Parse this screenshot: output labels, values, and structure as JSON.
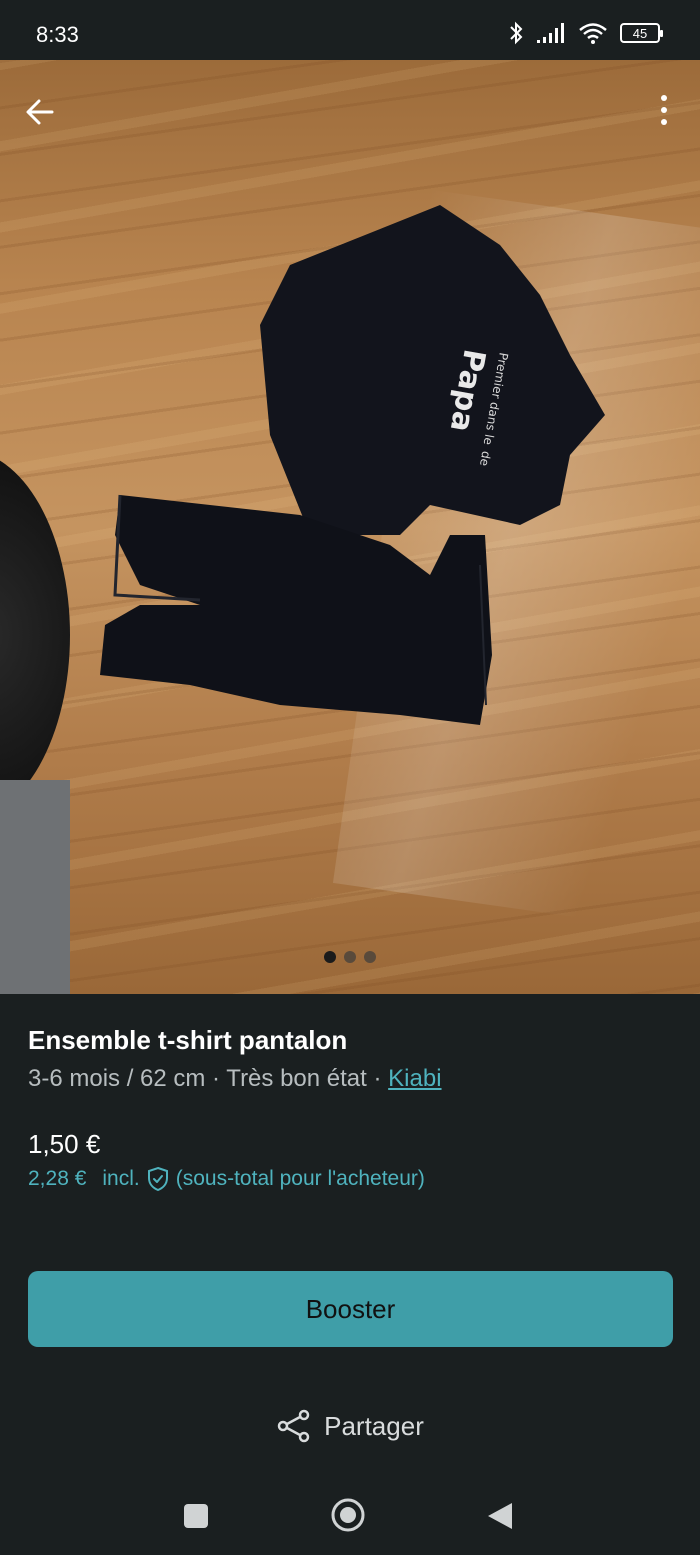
{
  "status_bar": {
    "time": "8:33",
    "battery": "45",
    "icons": [
      "bluetooth-icon",
      "signal-icon",
      "wifi-icon",
      "battery-icon"
    ]
  },
  "photo": {
    "indicator": {
      "count": 3,
      "active_index": 0
    },
    "shirt_print": {
      "line1": "Premier dans le",
      "line2": "Papa",
      "line3": "de"
    }
  },
  "item": {
    "title": "Ensemble t-shirt pantalon",
    "size": "3-6 mois / 62 cm",
    "separator": " · ",
    "condition": "Très bon état",
    "brand": "Kiabi"
  },
  "pricing": {
    "price": "1,50 €",
    "buyer_total": "2,28 €",
    "incl_label": "incl.",
    "buyer_note": "(sous-total pour l'acheteur)"
  },
  "actions": {
    "booster_label": "Booster",
    "share_label": "Partager"
  },
  "colors": {
    "background": "#1a1f20",
    "accent": "#3f9ea8",
    "link": "#4fb3be"
  }
}
